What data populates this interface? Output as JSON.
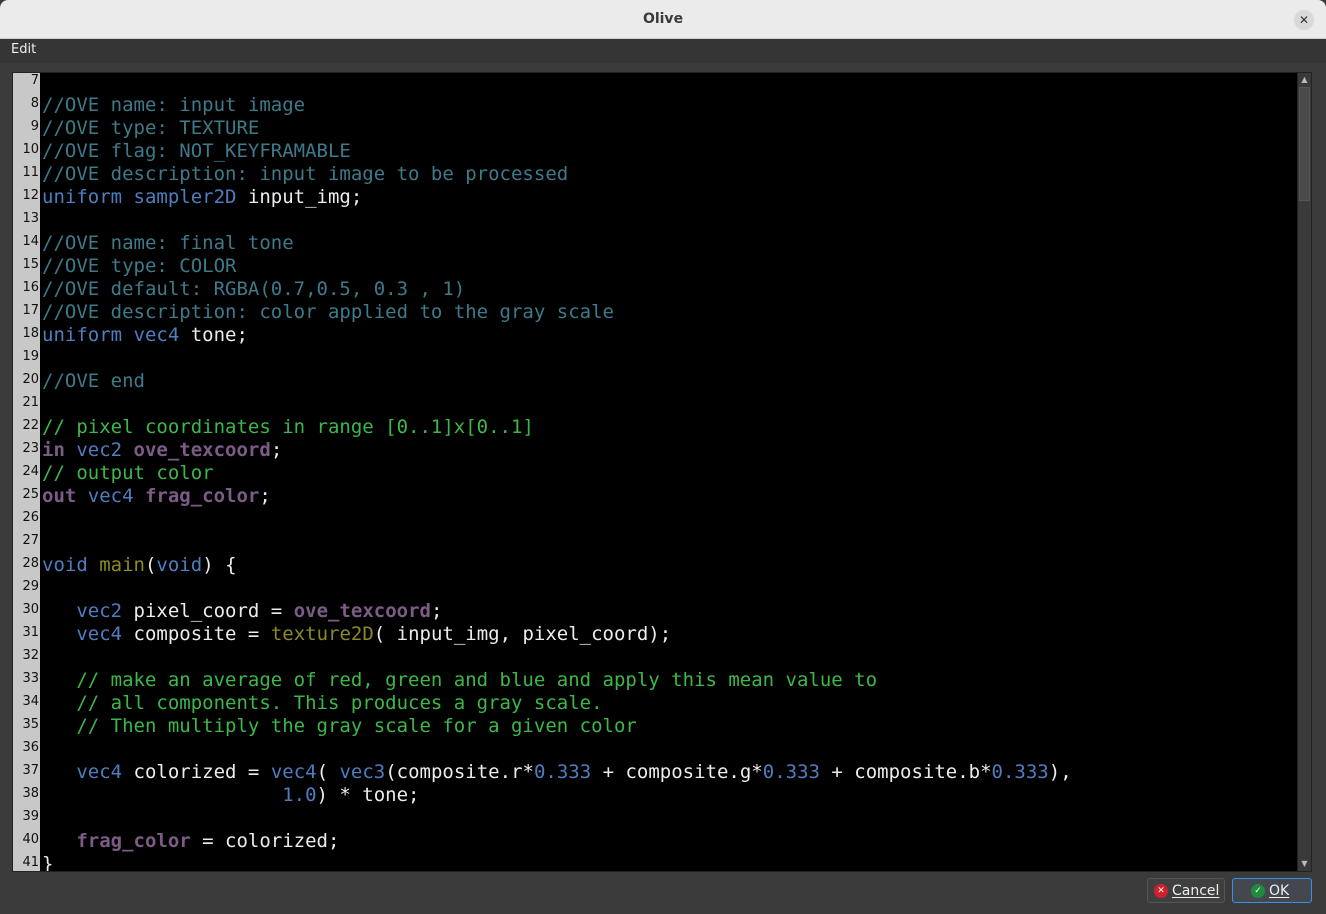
{
  "window": {
    "title": "Olive",
    "close_icon": "close-icon"
  },
  "menu": {
    "edit": "Edit"
  },
  "editor": {
    "lines": [
      {
        "n": "7",
        "t": []
      },
      {
        "n": "8",
        "t": [
          [
            "c",
            "//OVE name: input image"
          ]
        ]
      },
      {
        "n": "9",
        "t": [
          [
            "c",
            "//OVE type: TEXTURE"
          ]
        ]
      },
      {
        "n": "10",
        "t": [
          [
            "c",
            "//OVE flag: NOT_KEYFRAMABLE"
          ]
        ]
      },
      {
        "n": "11",
        "t": [
          [
            "c",
            "//OVE description: input image to be processed"
          ]
        ]
      },
      {
        "n": "12",
        "t": [
          [
            "k",
            "uniform sampler2D "
          ],
          [
            "t",
            "input_img;"
          ]
        ]
      },
      {
        "n": "13",
        "t": []
      },
      {
        "n": "14",
        "t": [
          [
            "c",
            "//OVE name: final tone"
          ]
        ]
      },
      {
        "n": "15",
        "t": [
          [
            "c",
            "//OVE type: COLOR"
          ]
        ]
      },
      {
        "n": "16",
        "t": [
          [
            "c",
            "//OVE default: RGBA(0.7,0.5, 0.3 , 1)"
          ]
        ]
      },
      {
        "n": "17",
        "t": [
          [
            "c",
            "//OVE description: color applied to the gray scale"
          ]
        ]
      },
      {
        "n": "18",
        "t": [
          [
            "k",
            "uniform vec4 "
          ],
          [
            "t",
            "tone;"
          ]
        ]
      },
      {
        "n": "19",
        "t": []
      },
      {
        "n": "20",
        "t": [
          [
            "c",
            "//OVE end"
          ]
        ]
      },
      {
        "n": "21",
        "t": []
      },
      {
        "n": "22",
        "t": [
          [
            "g",
            "// pixel coordinates in range [0..1]x[0..1]"
          ]
        ]
      },
      {
        "n": "23",
        "t": [
          [
            "pb",
            "in "
          ],
          [
            "k",
            "vec2 "
          ],
          [
            "pb",
            "ove_texcoord"
          ],
          [
            "t",
            ";"
          ]
        ]
      },
      {
        "n": "24",
        "t": [
          [
            "g",
            "// output color"
          ]
        ]
      },
      {
        "n": "25",
        "t": [
          [
            "pb",
            "out "
          ],
          [
            "k",
            "vec4 "
          ],
          [
            "pb",
            "frag_color"
          ],
          [
            "t",
            ";"
          ]
        ]
      },
      {
        "n": "26",
        "t": []
      },
      {
        "n": "27",
        "t": []
      },
      {
        "n": "28",
        "t": [
          [
            "k",
            "void "
          ],
          [
            "f",
            "main"
          ],
          [
            "t",
            "("
          ],
          [
            "k",
            "void"
          ],
          [
            "t",
            ") {"
          ]
        ]
      },
      {
        "n": "29",
        "t": []
      },
      {
        "n": "30",
        "t": [
          [
            "t",
            "   "
          ],
          [
            "k",
            "vec2 "
          ],
          [
            "t",
            "pixel_coord = "
          ],
          [
            "pb",
            "ove_texcoord"
          ],
          [
            "t",
            ";"
          ]
        ]
      },
      {
        "n": "31",
        "t": [
          [
            "t",
            "   "
          ],
          [
            "k",
            "vec4 "
          ],
          [
            "t",
            "composite = "
          ],
          [
            "f",
            "texture2D"
          ],
          [
            "t",
            "( input_img, pixel_coord);"
          ]
        ]
      },
      {
        "n": "32",
        "t": []
      },
      {
        "n": "33",
        "t": [
          [
            "g",
            "   // make an average of red, green and blue and apply this mean value to"
          ]
        ]
      },
      {
        "n": "34",
        "t": [
          [
            "g",
            "   // all components. This produces a gray scale."
          ]
        ]
      },
      {
        "n": "35",
        "t": [
          [
            "g",
            "   // Then multiply the gray scale for a given color"
          ]
        ]
      },
      {
        "n": "36",
        "t": []
      },
      {
        "n": "37",
        "t": [
          [
            "t",
            "   "
          ],
          [
            "k",
            "vec4 "
          ],
          [
            "t",
            "colorized = "
          ],
          [
            "k",
            "vec4"
          ],
          [
            "t",
            "( "
          ],
          [
            "k",
            "vec3"
          ],
          [
            "t",
            "(composite.r*"
          ],
          [
            "n",
            "0.333"
          ],
          [
            "t",
            " + composite.g*"
          ],
          [
            "n",
            "0.333"
          ],
          [
            "t",
            " + composite.b*"
          ],
          [
            "n",
            "0.333"
          ],
          [
            "t",
            "),"
          ]
        ]
      },
      {
        "n": "38",
        "t": [
          [
            "t",
            "                     "
          ],
          [
            "n",
            "1.0"
          ],
          [
            "t",
            ") * tone;"
          ]
        ]
      },
      {
        "n": "39",
        "t": []
      },
      {
        "n": "40",
        "t": [
          [
            "t",
            "   "
          ],
          [
            "pb",
            "frag_color"
          ],
          [
            "t",
            " = colorized;"
          ]
        ]
      },
      {
        "n": "41",
        "t": [
          [
            "t",
            "}"
          ]
        ]
      }
    ]
  },
  "buttons": {
    "cancel": "Cancel",
    "ok": "OK"
  },
  "colors": {
    "comment_ove": "#3e7a8a",
    "keyword": "#4f7dc0",
    "variable": "#7c5c86",
    "comment": "#3cb84a",
    "function": "#8d8a22",
    "accent": "#3a8ee6"
  }
}
